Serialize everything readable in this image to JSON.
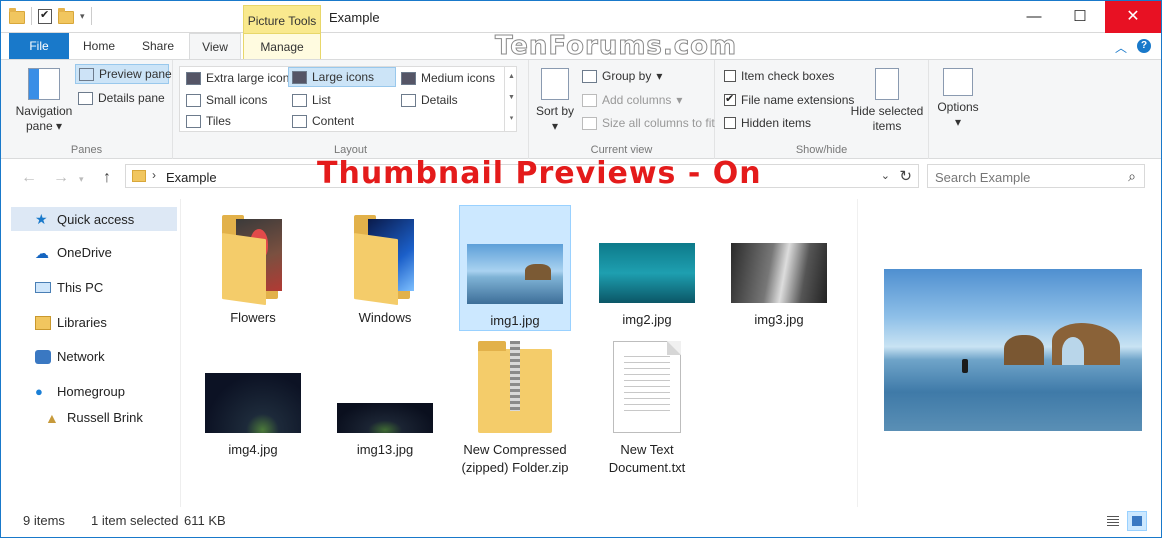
{
  "window": {
    "title": "Example",
    "context_tab_group": "Picture Tools",
    "controls": {
      "minimize": "—",
      "maximize": "☐",
      "close": "✕"
    }
  },
  "watermark": "TenForums.com",
  "headline": "Thumbnail Previews - On",
  "tabs": [
    {
      "label": "File"
    },
    {
      "label": "Home"
    },
    {
      "label": "Share"
    },
    {
      "label": "View"
    },
    {
      "label": "Manage"
    }
  ],
  "ribbon": {
    "panes": {
      "group_label": "Panes",
      "navigation_pane": "Navigation pane",
      "preview_pane": "Preview pane",
      "details_pane": "Details pane"
    },
    "layout": {
      "group_label": "Layout",
      "options": [
        "Extra large icons",
        "Large icons",
        "Medium icons",
        "Small icons",
        "List",
        "Details",
        "Tiles",
        "Content"
      ],
      "selected": "Large icons"
    },
    "current_view": {
      "group_label": "Current view",
      "sort_by": "Sort by",
      "group_by": "Group by",
      "add_columns": "Add columns",
      "size_all_columns": "Size all columns to fit"
    },
    "show_hide": {
      "group_label": "Show/hide",
      "item_check_boxes": {
        "label": "Item check boxes",
        "checked": false
      },
      "file_name_extensions": {
        "label": "File name extensions",
        "checked": true
      },
      "hidden_items": {
        "label": "Hidden items",
        "checked": false
      },
      "hide_selected_items": "Hide selected items"
    },
    "options": "Options"
  },
  "address": {
    "crumb": "Example",
    "search_placeholder": "Search Example"
  },
  "sidebar": {
    "items": [
      {
        "label": "Quick access"
      },
      {
        "label": "OneDrive"
      },
      {
        "label": "This PC"
      },
      {
        "label": "Libraries"
      },
      {
        "label": "Network"
      },
      {
        "label": "Homegroup"
      },
      {
        "label": "Russell Brink"
      }
    ]
  },
  "files": [
    {
      "name": "Flowers"
    },
    {
      "name": "Windows"
    },
    {
      "name": "img1.jpg"
    },
    {
      "name": "img2.jpg"
    },
    {
      "name": "img3.jpg"
    },
    {
      "name": "img4.jpg"
    },
    {
      "name": "img13.jpg"
    },
    {
      "name": "New Compressed (zipped) Folder.zip"
    },
    {
      "name": "New Text Document.txt"
    }
  ],
  "status": {
    "count": "9 items",
    "selection": "1 item selected",
    "size": "611 KB"
  }
}
